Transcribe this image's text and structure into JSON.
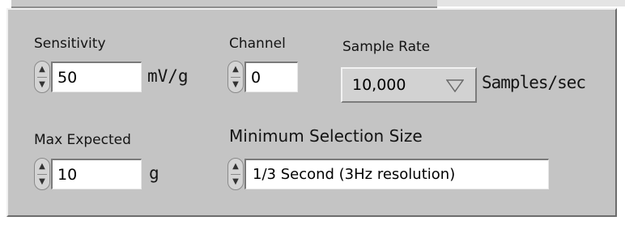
{
  "sensitivity": {
    "label": "Sensitivity",
    "value": "50",
    "unit": "mV/g"
  },
  "channel": {
    "label": "Channel",
    "value": "0"
  },
  "sample_rate": {
    "label": "Sample Rate",
    "value": "10,000",
    "unit": "Samples/sec"
  },
  "max_expected": {
    "label": "Max Expected",
    "value": "10",
    "unit": "g"
  },
  "min_selection": {
    "label": "Minimum Selection Size",
    "value": "1/3 Second (3Hz resolution)"
  },
  "icons": {
    "spinner": "numeric-spinner-icon",
    "dropdown": "triangle-down-icon"
  },
  "colors": {
    "panel": "#c4c4c4",
    "field": "#ffffff"
  }
}
